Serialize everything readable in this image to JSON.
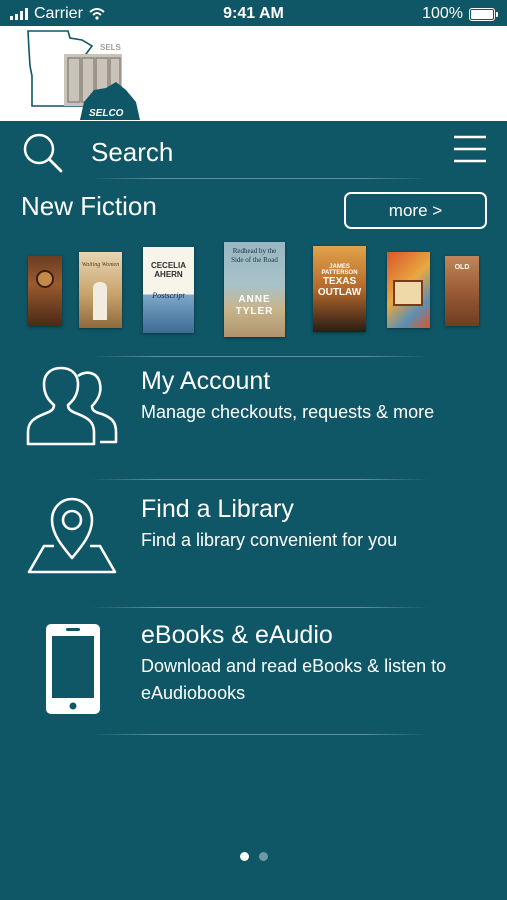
{
  "status_bar": {
    "carrier": "Carrier",
    "time": "9:41 AM",
    "battery": "100%"
  },
  "logo": {
    "small_text": "SELS",
    "main_text": "SELCO"
  },
  "search": {
    "label": "Search"
  },
  "new_fiction": {
    "title": "New Fiction",
    "more_label": "more >",
    "books": [
      {
        "title_text": "",
        "author_text": ""
      },
      {
        "title_text": "Waiting Women",
        "author_text": ""
      },
      {
        "title_text": "",
        "author_text": "CECELIA AHERN",
        "sub_text": "Postscript"
      },
      {
        "title_text": "Redhead by the Side of the Road",
        "author_text": "ANNE TYLER"
      },
      {
        "title_text": "TEXAS OUTLAW",
        "author_text": "JAMES PATTERSON"
      },
      {
        "title_text": "",
        "author_text": ""
      },
      {
        "title_text": "OLD",
        "author_text": ""
      }
    ]
  },
  "menu": [
    {
      "title": "My Account",
      "subtitle": "Manage checkouts, requests & more"
    },
    {
      "title": "Find a Library",
      "subtitle": "Find a library convenient for you"
    },
    {
      "title": "eBooks & eAudio",
      "subtitle": "Download and read eBooks & listen to eAudiobooks"
    }
  ],
  "colors": {
    "background": "#0f5666",
    "header": "#ffffff",
    "text": "#ffffff",
    "logo_teal": "#0f5666",
    "logo_tan": "#a59e93"
  },
  "page_indicator": {
    "current": 1,
    "total": 2
  }
}
